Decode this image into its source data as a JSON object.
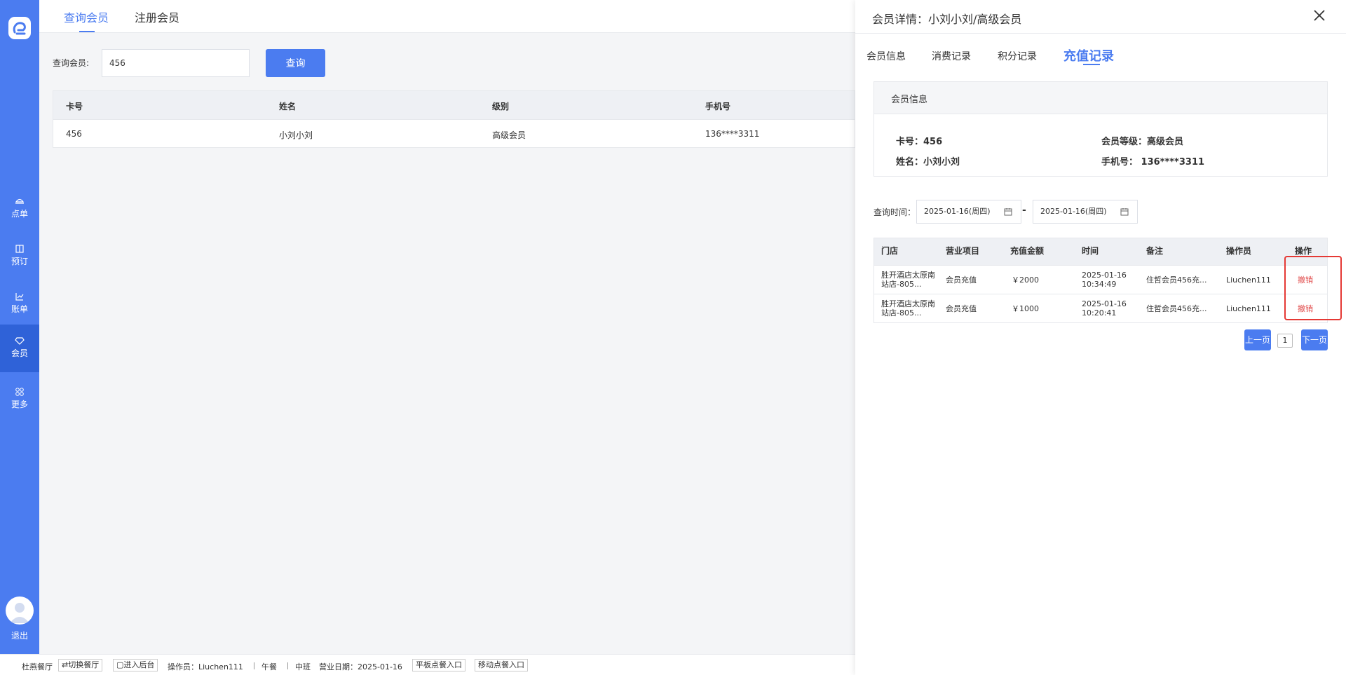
{
  "sidebar": {
    "items": [
      {
        "label": "点单",
        "icon": "food-icon"
      },
      {
        "label": "预订",
        "icon": "book-icon"
      },
      {
        "label": "账单",
        "icon": "chart-icon"
      },
      {
        "label": "会员",
        "icon": "diamond-icon"
      },
      {
        "label": "更多",
        "icon": "grid-icon"
      }
    ],
    "active_index": 3,
    "logout_label": "退出"
  },
  "top_tabs": [
    "查询会员",
    "注册会员"
  ],
  "search": {
    "label": "查询会员:",
    "value": "456",
    "button_label": "查询"
  },
  "member_table": {
    "headers": [
      "卡号",
      "姓名",
      "级别",
      "手机号"
    ],
    "rows": [
      [
        "456",
        "小刘小刘",
        "高级会员",
        "136****3311"
      ]
    ]
  },
  "drawer": {
    "title": "会员详情：小刘小刘/高级会员",
    "tabs": [
      "会员信息",
      "消费记录",
      "积分记录",
      "充值记录"
    ],
    "active_tab": 3,
    "info_card": {
      "title": "会员信息",
      "card_no": "卡号：456",
      "level": "会员等级：高级会员",
      "name": "姓名：小刘小刘",
      "phone": "手机号：  136****3311"
    },
    "date_filter": {
      "label": "查询时间：",
      "start": "2025-01-16(周四)",
      "separator": "-",
      "end": "2025-01-16(周四)"
    },
    "records": {
      "headers": [
        "门店",
        "营业项目",
        "充值金额",
        "时间",
        "备注",
        "操作员",
        "操作"
      ],
      "rows": [
        {
          "store": "胜开酒店太原南站店-805...",
          "item": "会员充值",
          "amount": "￥2000",
          "time": "2025-01-16 10:34:49",
          "note": "住哲会员456充...",
          "operator": "Liuchen111",
          "action": "撤销"
        },
        {
          "store": "胜开酒店太原南站店-805...",
          "item": "会员充值",
          "amount": "￥1000",
          "time": "2025-01-16 10:20:41",
          "note": "住哲会员456充...",
          "operator": "Liuchen111",
          "action": "撤销"
        }
      ]
    },
    "pagination": {
      "prev": "上一页",
      "page": "1",
      "next": "下一页"
    }
  },
  "status_bar": {
    "restaurant": "杜燕餐厅",
    "switch_label": "切换餐厅",
    "backend_label": "进入后台",
    "operator": "操作员：Liuchen111",
    "meal": "午餐",
    "shift": "中班",
    "business_date": "营业日期：2025-01-16",
    "tablet_label": "平板点餐入口",
    "mobile_label": "移动点餐入口"
  },
  "colors": {
    "primary": "#4b7cf0",
    "sidebar_active": "#2f62d8",
    "revoke": "#e14c4c",
    "highlight": "#e53935"
  }
}
